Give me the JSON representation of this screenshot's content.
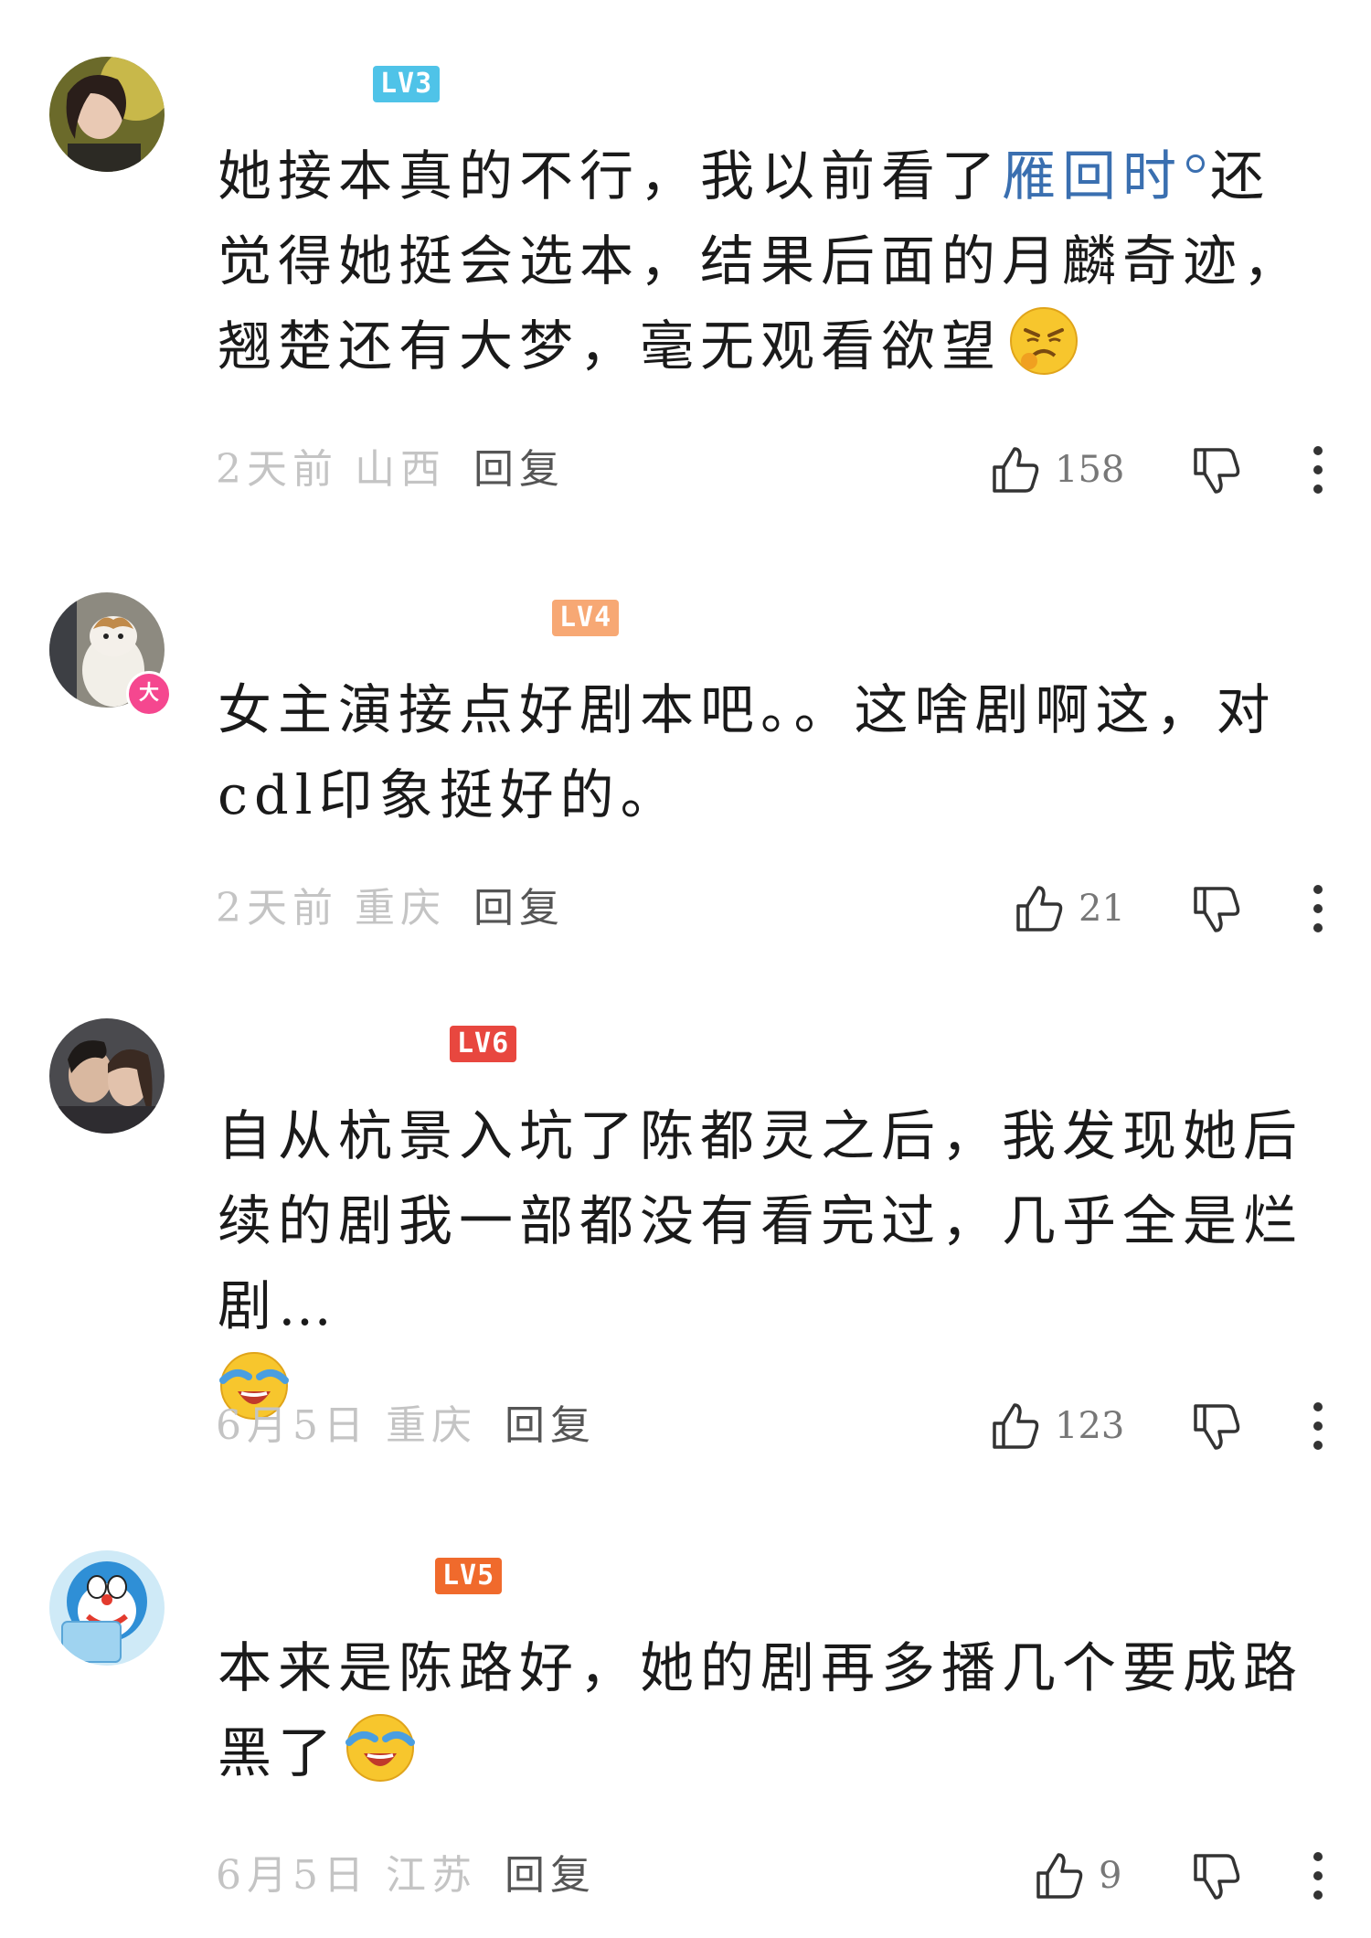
{
  "comments": [
    {
      "level": "LV3",
      "level_color": "#4fc3e8",
      "text_before": "她接本真的不行，我以前看了",
      "link": "雁回时",
      "text_after": "还觉得她挺会选本，结果后面的月麟奇迹，翘楚还有大梦，毫无观看欲望",
      "emoji": "angry-face-icon",
      "time": "2天前",
      "location": "山西",
      "reply": "回复",
      "likes": "158"
    },
    {
      "level": "LV4",
      "level_color": "#f7a874",
      "badge": "大",
      "text": "女主演接点好剧本吧。。这啥剧啊这，对cdl印象挺好的。",
      "time": "2天前",
      "location": "重庆",
      "reply": "回复",
      "likes": "21"
    },
    {
      "level": "LV6",
      "level_color": "#e8473f",
      "text": "自从杭景入坑了陈都灵之后，我发现她后续的剧我一部都没有看完过，几乎全是烂剧…",
      "emoji": "laugh-cry-icon",
      "time": "6月5日",
      "location": "重庆",
      "reply": "回复",
      "likes": "123"
    },
    {
      "level": "LV5",
      "level_color": "#f06a2c",
      "text": "本来是陈路好，她的剧再多播几个要成路黑了",
      "emoji": "laugh-cry-icon",
      "time": "6月5日",
      "location": "江苏",
      "reply": "回复",
      "likes": "9"
    }
  ]
}
